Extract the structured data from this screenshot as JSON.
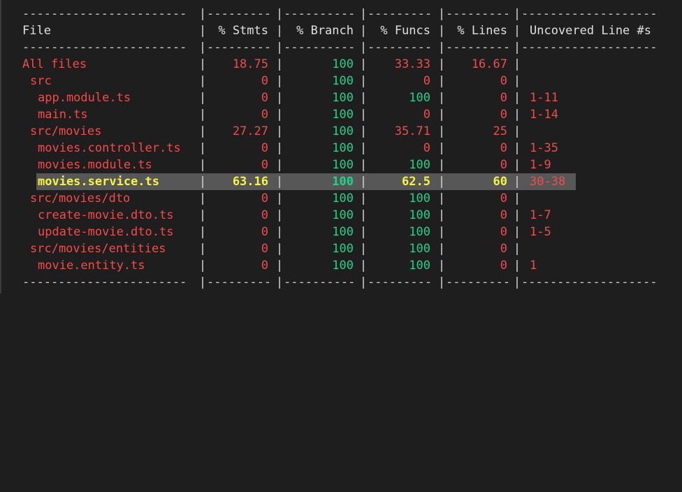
{
  "separator": {
    "file": "-----------------------",
    "stmts": "---------",
    "branch": "----------",
    "funcs": "---------",
    "lines": "---------",
    "uncovered": "-------------------"
  },
  "header": {
    "file": "File",
    "stmts": "% Stmts",
    "branch": "% Branch",
    "funcs": "% Funcs",
    "lines": "% Lines",
    "uncovered": "Uncovered Line #s"
  },
  "rows": [
    {
      "file": "All files",
      "indent": 0,
      "stmts": "18.75",
      "branch": "100",
      "funcs": "33.33",
      "lines": "16.67",
      "uncovered": ""
    },
    {
      "file": "src",
      "indent": 1,
      "stmts": "0",
      "branch": "100",
      "funcs": "0",
      "lines": "0",
      "uncovered": ""
    },
    {
      "file": "app.module.ts",
      "indent": 2,
      "stmts": "0",
      "branch": "100",
      "funcs": "100",
      "lines": "0",
      "uncovered": "1-11"
    },
    {
      "file": "main.ts",
      "indent": 2,
      "stmts": "0",
      "branch": "100",
      "funcs": "0",
      "lines": "0",
      "uncovered": "1-14"
    },
    {
      "file": "src/movies",
      "indent": 1,
      "stmts": "27.27",
      "branch": "100",
      "funcs": "35.71",
      "lines": "25",
      "uncovered": ""
    },
    {
      "file": "movies.controller.ts",
      "indent": 2,
      "stmts": "0",
      "branch": "100",
      "funcs": "0",
      "lines": "0",
      "uncovered": "1-35"
    },
    {
      "file": "movies.module.ts",
      "indent": 2,
      "stmts": "0",
      "branch": "100",
      "funcs": "100",
      "lines": "0",
      "uncovered": "1-9"
    },
    {
      "file": "movies.service.ts",
      "indent": 2,
      "stmts": "63.16",
      "branch": "100",
      "funcs": "62.5",
      "lines": "60",
      "uncovered": "30-38",
      "selected": true
    },
    {
      "file": "src/movies/dto",
      "indent": 1,
      "stmts": "0",
      "branch": "100",
      "funcs": "100",
      "lines": "0",
      "uncovered": ""
    },
    {
      "file": "create-movie.dto.ts",
      "indent": 2,
      "stmts": "0",
      "branch": "100",
      "funcs": "100",
      "lines": "0",
      "uncovered": "1-7"
    },
    {
      "file": "update-movie.dto.ts",
      "indent": 2,
      "stmts": "0",
      "branch": "100",
      "funcs": "100",
      "lines": "0",
      "uncovered": "1-5"
    },
    {
      "file": "src/movies/entities",
      "indent": 1,
      "stmts": "0",
      "branch": "100",
      "funcs": "100",
      "lines": "0",
      "uncovered": ""
    },
    {
      "file": "movie.entity.ts",
      "indent": 2,
      "stmts": "0",
      "branch": "100",
      "funcs": "100",
      "lines": "0",
      "uncovered": "1"
    }
  ],
  "colors": {
    "background": "#1e1e1e",
    "low_coverage": "#f14c4c",
    "full_coverage": "#23d18b",
    "medium_coverage": "#f5f543",
    "selection": "#575757"
  }
}
